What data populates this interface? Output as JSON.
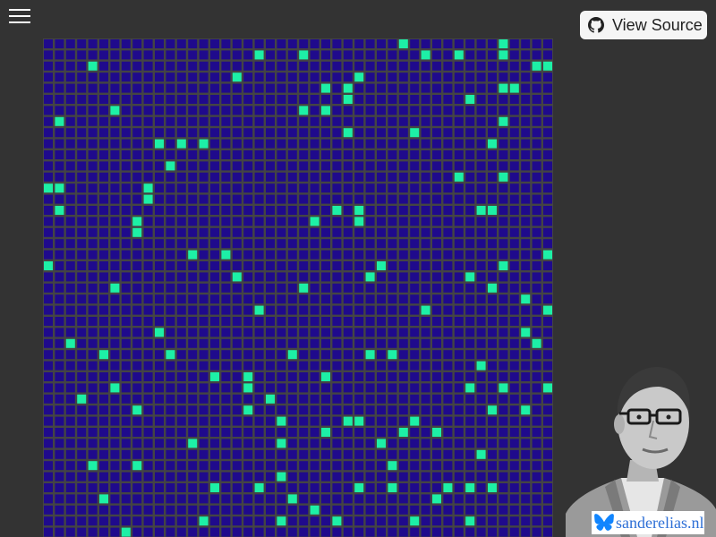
{
  "header": {
    "menu_icon": "hamburger-menu-icon",
    "view_source_label": "View Source",
    "view_source_icon": "github-icon"
  },
  "game": {
    "type": "game-of-life-grid",
    "columns": 46,
    "rows": 45,
    "colors": {
      "dead": "#1f0a8c",
      "alive": "#1df0a6",
      "gridline": "#444444",
      "background": "#333333"
    },
    "alive_cells": [
      [
        32,
        0
      ],
      [
        41,
        0
      ],
      [
        19,
        1
      ],
      [
        23,
        1
      ],
      [
        34,
        1
      ],
      [
        37,
        1
      ],
      [
        41,
        1
      ],
      [
        4,
        2
      ],
      [
        44,
        2
      ],
      [
        45,
        2
      ],
      [
        17,
        3
      ],
      [
        28,
        3
      ],
      [
        25,
        4
      ],
      [
        27,
        4
      ],
      [
        41,
        4
      ],
      [
        42,
        4
      ],
      [
        27,
        5
      ],
      [
        38,
        5
      ],
      [
        6,
        6
      ],
      [
        23,
        6
      ],
      [
        25,
        6
      ],
      [
        1,
        7
      ],
      [
        41,
        7
      ],
      [
        27,
        8
      ],
      [
        33,
        8
      ],
      [
        10,
        9
      ],
      [
        12,
        9
      ],
      [
        14,
        9
      ],
      [
        40,
        9
      ],
      [
        11,
        11
      ],
      [
        37,
        12
      ],
      [
        41,
        12
      ],
      [
        0,
        13
      ],
      [
        1,
        13
      ],
      [
        9,
        13
      ],
      [
        9,
        14
      ],
      [
        1,
        15
      ],
      [
        26,
        15
      ],
      [
        28,
        15
      ],
      [
        39,
        15
      ],
      [
        40,
        15
      ],
      [
        8,
        16
      ],
      [
        24,
        16
      ],
      [
        28,
        16
      ],
      [
        8,
        17
      ],
      [
        13,
        19
      ],
      [
        16,
        19
      ],
      [
        45,
        19
      ],
      [
        0,
        20
      ],
      [
        30,
        20
      ],
      [
        41,
        20
      ],
      [
        17,
        21
      ],
      [
        29,
        21
      ],
      [
        38,
        21
      ],
      [
        6,
        22
      ],
      [
        23,
        22
      ],
      [
        40,
        22
      ],
      [
        43,
        23
      ],
      [
        19,
        24
      ],
      [
        34,
        24
      ],
      [
        45,
        24
      ],
      [
        10,
        26
      ],
      [
        43,
        26
      ],
      [
        2,
        27
      ],
      [
        44,
        27
      ],
      [
        5,
        28
      ],
      [
        11,
        28
      ],
      [
        22,
        28
      ],
      [
        29,
        28
      ],
      [
        31,
        28
      ],
      [
        39,
        29
      ],
      [
        15,
        30
      ],
      [
        18,
        30
      ],
      [
        25,
        30
      ],
      [
        6,
        31
      ],
      [
        18,
        31
      ],
      [
        38,
        31
      ],
      [
        41,
        31
      ],
      [
        45,
        31
      ],
      [
        3,
        32
      ],
      [
        20,
        32
      ],
      [
        8,
        33
      ],
      [
        18,
        33
      ],
      [
        40,
        33
      ],
      [
        43,
        33
      ],
      [
        21,
        34
      ],
      [
        27,
        34
      ],
      [
        28,
        34
      ],
      [
        33,
        34
      ],
      [
        25,
        35
      ],
      [
        32,
        35
      ],
      [
        35,
        35
      ],
      [
        13,
        36
      ],
      [
        21,
        36
      ],
      [
        30,
        36
      ],
      [
        39,
        37
      ],
      [
        4,
        38
      ],
      [
        8,
        38
      ],
      [
        31,
        38
      ],
      [
        21,
        39
      ],
      [
        15,
        40
      ],
      [
        19,
        40
      ],
      [
        28,
        40
      ],
      [
        31,
        40
      ],
      [
        36,
        40
      ],
      [
        38,
        40
      ],
      [
        40,
        40
      ],
      [
        5,
        41
      ],
      [
        22,
        41
      ],
      [
        35,
        41
      ],
      [
        24,
        42
      ],
      [
        14,
        43
      ],
      [
        21,
        43
      ],
      [
        26,
        43
      ],
      [
        33,
        43
      ],
      [
        38,
        43
      ],
      [
        7,
        44
      ]
    ]
  },
  "badge": {
    "icon": "butterfly-icon",
    "text": "sanderelias.nl"
  },
  "portrait": {
    "icon": "author-portrait-photo"
  }
}
